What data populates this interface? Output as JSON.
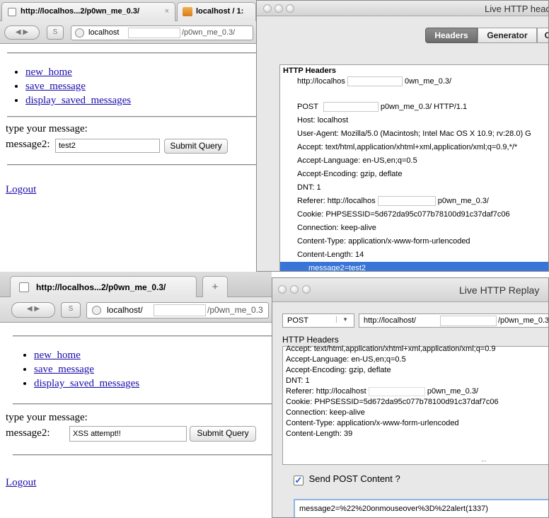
{
  "top_browser": {
    "tabs": [
      {
        "label": "http://localhos...2/p0wn_me_0.3/",
        "close": "×"
      },
      {
        "label": "localhost / 1:"
      }
    ],
    "url": "localhost",
    "url_path": "/p0wn_me_0.3/"
  },
  "top_page": {
    "links": [
      "new_home",
      "save_message",
      "display_saved_messages"
    ],
    "prompt": "type your message:",
    "field_label": "message2:",
    "field_value": "test2",
    "submit": "Submit Query",
    "logout": "Logout"
  },
  "headers_window": {
    "title": "Live HTTP heade",
    "tabs": [
      "Headers",
      "Generator",
      "C"
    ],
    "section": "HTTP Headers",
    "url_line_a": "http://localhos",
    "url_line_b": "0wn_me_0.3/",
    "post_a": "POST",
    "post_b": "p0wn_me_0.3/ HTTP/1.1",
    "lines": [
      "Host: localhost",
      "User-Agent: Mozilla/5.0 (Macintosh; Intel Mac OS X 10.9; rv:28.0) G",
      "Accept: text/html,application/xhtml+xml,application/xml;q=0.9,*/*",
      "Accept-Language: en-US,en;q=0.5",
      "Accept-Encoding: gzip, deflate",
      "DNT: 1"
    ],
    "referer_a": "Referer: http://localhos",
    "referer_b": "p0wn_me_0.3/",
    "lines2": [
      "Cookie: PHPSESSID=5d672da95c077b78100d91c37daf7c06",
      "Connection: keep-alive",
      "Content-Type: application/x-www-form-urlencoded",
      "Content-Length: 14"
    ],
    "selected": "message2=test2"
  },
  "bottom_browser": {
    "tab": "http://localhos...2/p0wn_me_0.3/",
    "new_tab": "+",
    "url": "localhost/",
    "url_path": "/p0wn_me_0.3"
  },
  "bottom_page": {
    "links": [
      "new_home",
      "save_message",
      "display_saved_messages"
    ],
    "prompt": "type your message:",
    "field_label": "message2:",
    "field_value": "XSS attempt!!",
    "submit": "Submit Query",
    "logout": "Logout"
  },
  "replay_window": {
    "title": "Live HTTP Replay",
    "method": "POST",
    "url_a": "http://localhost/",
    "url_b": "/p0wn_me_0.3/",
    "section": "HTTP Headers",
    "lines": [
      "Accept: text/html,application/xhtml+xml,application/xml;q=0.9",
      "Accept-Language: en-US,en;q=0.5",
      "Accept-Encoding: gzip, deflate",
      "DNT: 1"
    ],
    "referer_a": "Referer: http://localhost",
    "referer_b": "p0wn_me_0.3/",
    "lines2": [
      "Cookie: PHPSESSID=5d672da95c077b78100d91c37daf7c06",
      "Connection: keep-alive",
      "Content-Type: application/x-www-form-urlencoded",
      "Content-Length: 39"
    ],
    "checkbox_label": "Send POST Content ?",
    "checkbox_checked": true,
    "post_content": "message2=%22%20onmouseover%3D%22alert(1337)"
  }
}
